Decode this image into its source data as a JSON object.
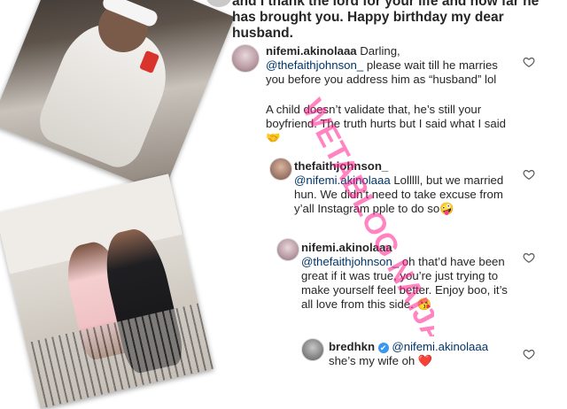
{
  "post": {
    "text": "and I thank the lord for your life and how far he has brought you. Happy birthday my dear husband."
  },
  "comments": [
    {
      "username": "nifemi.akinolaaa",
      "lead": "Darling,",
      "mention": "@thefaithjohnson_",
      "body": " please wait till he marries you before you address him as “husband” lol",
      "body2": "A child doesn’t validate that, he’s still your boyfriend. The truth hurts but I said what I said 🤝"
    },
    {
      "username": "thefaithjohnson_",
      "mention": "@nifemi.akinolaaa",
      "body": " Lolllll, but we married hun. We didn’t need to take excuse from y’all Instagram pple to do so🤪"
    },
    {
      "username": "nifemi.akinolaaa",
      "mention": "@thefaithjohnson_",
      "body": " oh that’d have been great if it was true, you’re just trying to make yourself feel better. Enjoy boo, it’s all love from this side. 😘"
    },
    {
      "username": "bredhkn",
      "verified": "✔",
      "mention": "@nifemi.akinolaaa",
      "body": "she’s my wife oh ❤️"
    }
  ],
  "watermark": "WETABLOG NAIJA",
  "colors": {
    "mention": "#003569",
    "watermark": "#ff1f8e",
    "verified": "#3897f0"
  },
  "icons": {
    "like": "heart-outline-icon"
  }
}
